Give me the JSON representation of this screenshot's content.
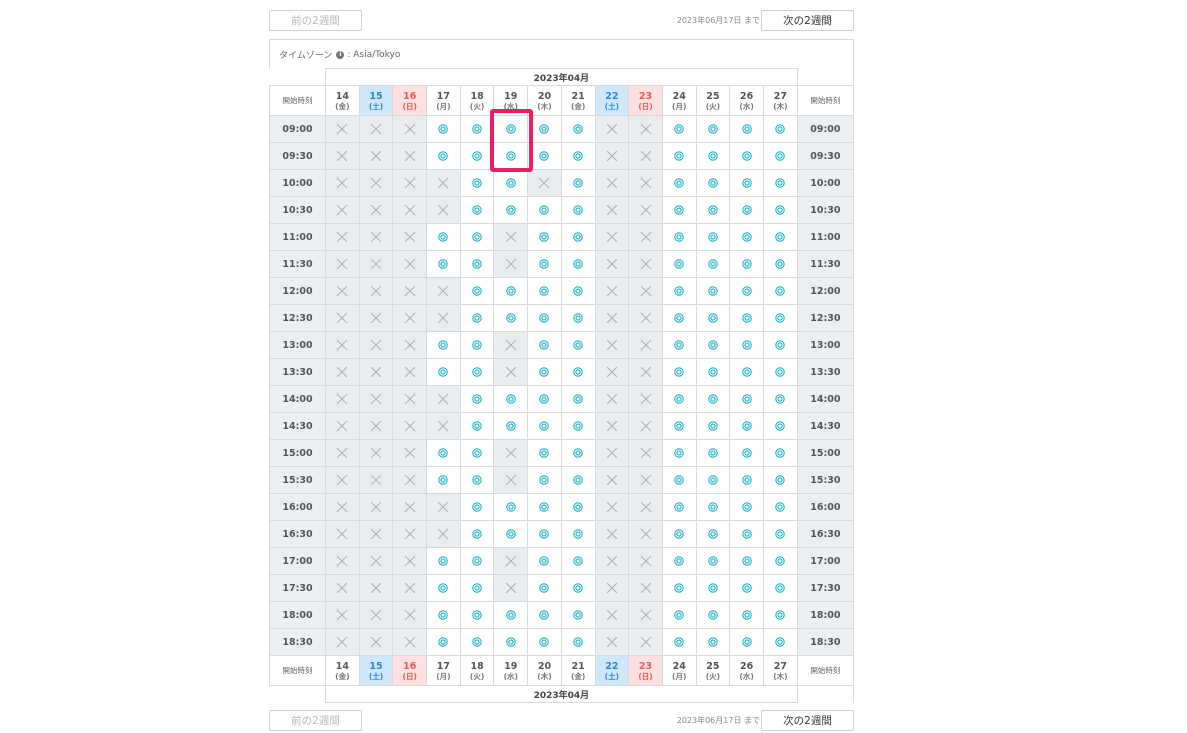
{
  "nav": {
    "prev_label": "前の2週間",
    "next_label": "次の2週間",
    "until_text": "2023年06月17日 まで"
  },
  "timezone": {
    "label": "タイムゾーン",
    "value": ": Asia/Tokyo"
  },
  "month_label": "2023年04月",
  "side_label": "開始時刻",
  "days": [
    {
      "num": "14",
      "dow": "(金)",
      "type": "weekday"
    },
    {
      "num": "15",
      "dow": "(土)",
      "type": "sat"
    },
    {
      "num": "16",
      "dow": "(日)",
      "type": "sun"
    },
    {
      "num": "17",
      "dow": "(月)",
      "type": "weekday"
    },
    {
      "num": "18",
      "dow": "(火)",
      "type": "weekday"
    },
    {
      "num": "19",
      "dow": "(水)",
      "type": "weekday"
    },
    {
      "num": "20",
      "dow": "(木)",
      "type": "weekday"
    },
    {
      "num": "21",
      "dow": "(金)",
      "type": "weekday"
    },
    {
      "num": "22",
      "dow": "(土)",
      "type": "sat"
    },
    {
      "num": "23",
      "dow": "(日)",
      "type": "sun"
    },
    {
      "num": "24",
      "dow": "(月)",
      "type": "weekday"
    },
    {
      "num": "25",
      "dow": "(火)",
      "type": "weekday"
    },
    {
      "num": "26",
      "dow": "(水)",
      "type": "weekday"
    },
    {
      "num": "27",
      "dow": "(木)",
      "type": "weekday"
    }
  ],
  "slots": [
    {
      "time": "09:00",
      "avail": "xxxoooooxxoooo"
    },
    {
      "time": "09:30",
      "avail": "xxxoooooxxoooo"
    },
    {
      "time": "10:00",
      "avail": "xxxxooxoxxoooo"
    },
    {
      "time": "10:30",
      "avail": "xxxxooooxxoooo"
    },
    {
      "time": "11:00",
      "avail": "xxxooxooxxoooo"
    },
    {
      "time": "11:30",
      "avail": "xxxooxooxxoooo"
    },
    {
      "time": "12:00",
      "avail": "xxxxooooxxoooo"
    },
    {
      "time": "12:30",
      "avail": "xxxxooooxxoooo"
    },
    {
      "time": "13:00",
      "avail": "xxxooxooxxoooo"
    },
    {
      "time": "13:30",
      "avail": "xxxooxooxxoooo"
    },
    {
      "time": "14:00",
      "avail": "xxxxooooxxoooo"
    },
    {
      "time": "14:30",
      "avail": "xxxxooooxxoooo"
    },
    {
      "time": "15:00",
      "avail": "xxxooxooxxoooo"
    },
    {
      "time": "15:30",
      "avail": "xxxooxooxxoooo"
    },
    {
      "time": "16:00",
      "avail": "xxxxooooxxoooo"
    },
    {
      "time": "16:30",
      "avail": "xxxxooooxxoooo"
    },
    {
      "time": "17:00",
      "avail": "xxxooxooxxoooo"
    },
    {
      "time": "17:30",
      "avail": "xxxooxooxxoooo"
    },
    {
      "time": "18:00",
      "avail": "xxxoooooxxoooo"
    },
    {
      "time": "18:30",
      "avail": "xxxoooooxxoooo"
    }
  ],
  "colors": {
    "available": "#1ab3c6",
    "unavailable": "#a9b3bb",
    "highlight": "#ee1d63"
  }
}
